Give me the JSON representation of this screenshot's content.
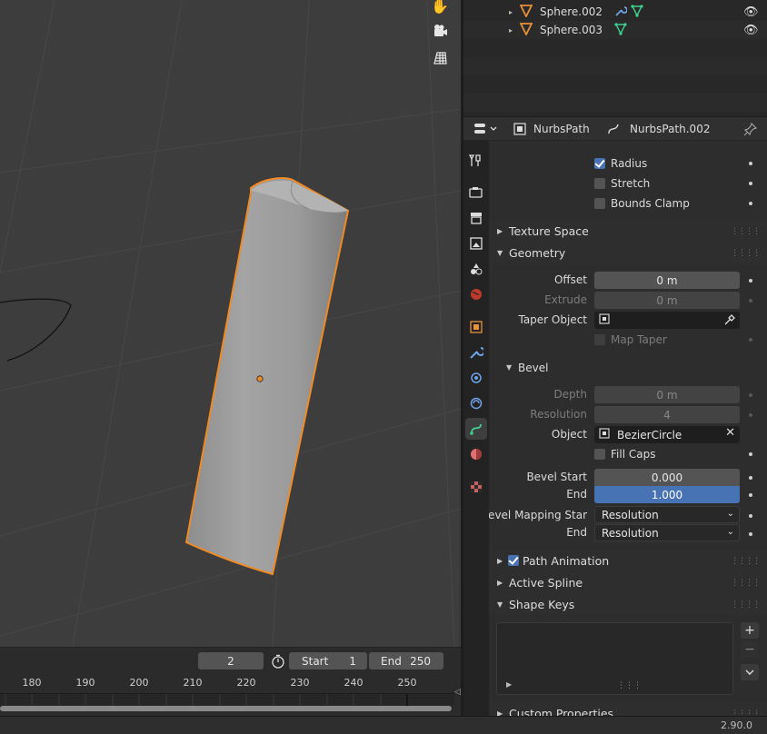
{
  "outliner": {
    "rows": [
      {
        "name": "Sphere.002",
        "icon": "mesh-triangle-icon",
        "has_modifier": true
      },
      {
        "name": "Sphere.003",
        "icon": "mesh-triangle-icon",
        "has_modifier": false
      }
    ]
  },
  "properties": {
    "header": {
      "object_name": "NurbsPath",
      "data_name": "NurbsPath.002"
    },
    "checkboxes_top": [
      {
        "label": "Radius",
        "checked": true
      },
      {
        "label": "Stretch",
        "checked": false
      },
      {
        "label": "Bounds Clamp",
        "checked": false
      }
    ],
    "panels": {
      "texture_space": "Texture Space",
      "geometry": "Geometry",
      "bevel": "Bevel",
      "path_animation": "Path Animation",
      "active_spline": "Active Spline",
      "shape_keys": "Shape Keys",
      "custom_properties": "Custom Properties"
    },
    "geometry": {
      "offset_label": "Offset",
      "offset_value": "0 m",
      "extrude_label": "Extrude",
      "extrude_value": "0 m",
      "taper_label": "Taper Object",
      "map_taper_label": "Map Taper"
    },
    "bevel": {
      "depth_label": "Depth",
      "depth_value": "0 m",
      "resolution_label": "Resolution",
      "resolution_value": "4",
      "object_label": "Object",
      "object_value": "BezierCircle",
      "fill_caps_label": "Fill Caps",
      "bevel_start_label": "Bevel Start",
      "bevel_start_value": "0.000",
      "end_label": "End",
      "end_value": "1.000",
      "mapping_start_label": "Bevel Mapping Star",
      "mapping_start_value": "Resolution",
      "mapping_end_label": "End",
      "mapping_end_value": "Resolution"
    }
  },
  "timeline": {
    "current_frame": "2",
    "start_label": "Start",
    "start_value": "1",
    "end_label": "End",
    "end_value": "250",
    "frame_numbers": [
      "180",
      "190",
      "200",
      "210",
      "220",
      "230",
      "240",
      "250"
    ]
  },
  "status": {
    "version": "2.90.0"
  },
  "colors": {
    "selection_outline": "#f08a24",
    "accent_blue": "#4772b3",
    "viewport_bg": "#3d3d3d"
  }
}
